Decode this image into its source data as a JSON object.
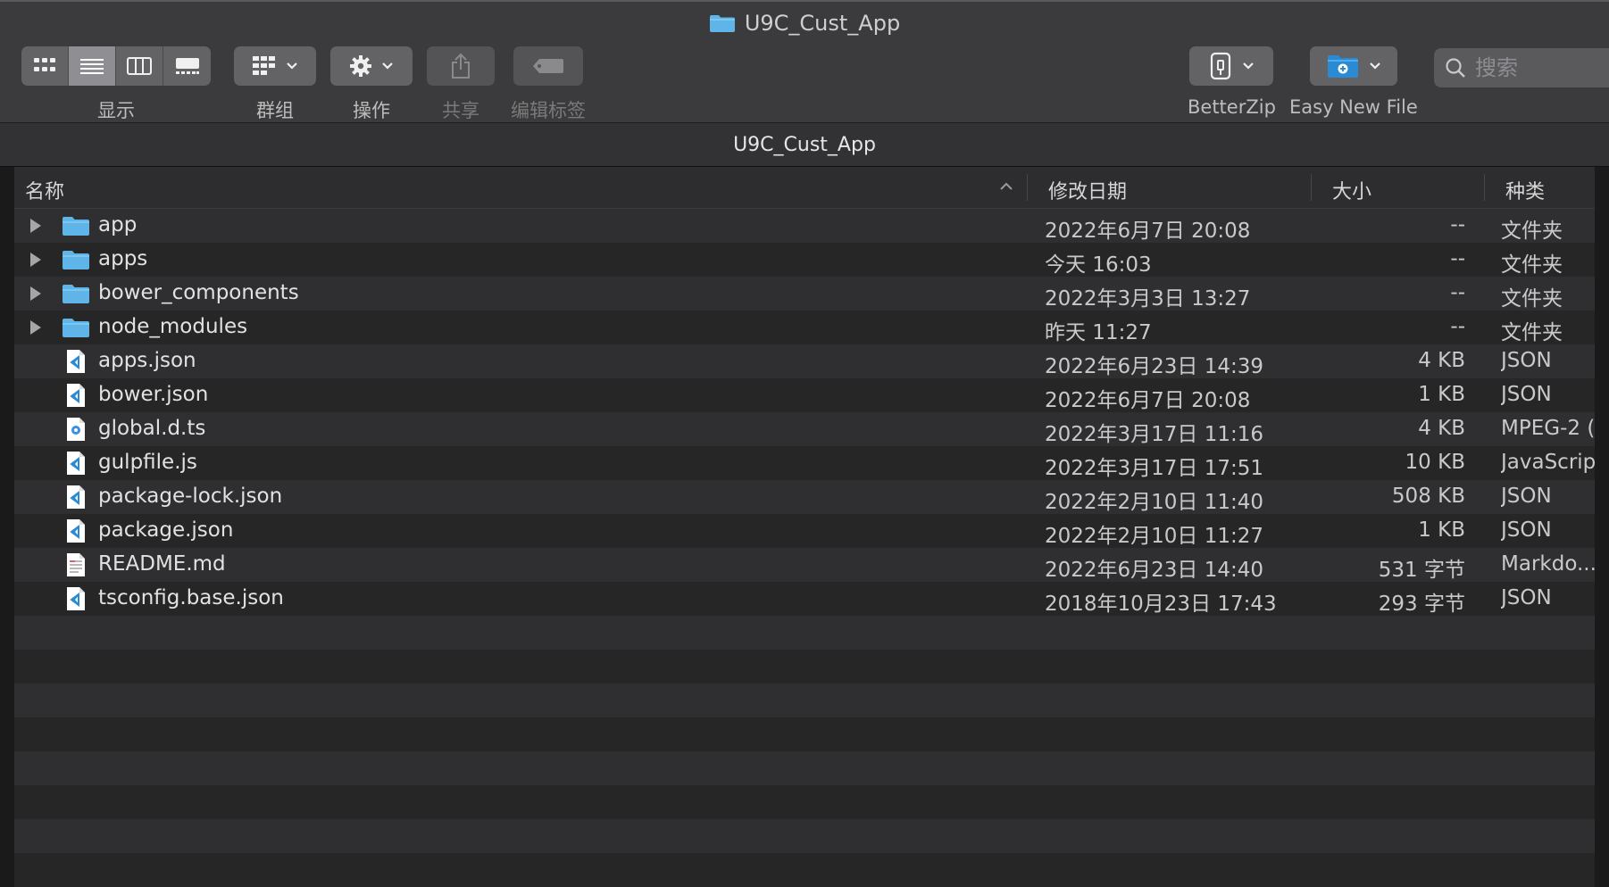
{
  "window": {
    "title": "U9C_Cust_App",
    "path_title": "U9C_Cust_App"
  },
  "toolbar": {
    "view_label": "显示",
    "group_label": "群组",
    "action_label": "操作",
    "share_label": "共享",
    "tags_label": "编辑标签",
    "betterzip_label": "BetterZip",
    "easynewfile_label": "Easy New File",
    "search_placeholder": "搜索"
  },
  "columns": {
    "name": "名称",
    "modified": "修改日期",
    "size": "大小",
    "kind": "种类"
  },
  "files": [
    {
      "name": "app",
      "modified": "2022年6月7日 20:08",
      "size": "--",
      "kind": "文件夹",
      "type": "folder"
    },
    {
      "name": "apps",
      "modified": "今天 16:03",
      "size": "--",
      "kind": "文件夹",
      "type": "folder"
    },
    {
      "name": "bower_components",
      "modified": "2022年3月3日 13:27",
      "size": "--",
      "kind": "文件夹",
      "type": "folder"
    },
    {
      "name": "node_modules",
      "modified": "昨天 11:27",
      "size": "--",
      "kind": "文件夹",
      "type": "folder"
    },
    {
      "name": "apps.json",
      "modified": "2022年6月23日 14:39",
      "size": "4 KB",
      "kind": "JSON",
      "type": "vscode"
    },
    {
      "name": "bower.json",
      "modified": "2022年6月7日 20:08",
      "size": "1 KB",
      "kind": "JSON",
      "type": "vscode"
    },
    {
      "name": "global.d.ts",
      "modified": "2022年3月17日 11:16",
      "size": "4 KB",
      "kind": "MPEG-2 (",
      "type": "media"
    },
    {
      "name": "gulpfile.js",
      "modified": "2022年3月17日 17:51",
      "size": "10 KB",
      "kind": "JavaScrip",
      "type": "vscode"
    },
    {
      "name": "package-lock.json",
      "modified": "2022年2月10日 11:40",
      "size": "508 KB",
      "kind": "JSON",
      "type": "vscode"
    },
    {
      "name": "package.json",
      "modified": "2022年2月10日 11:27",
      "size": "1 KB",
      "kind": "JSON",
      "type": "vscode"
    },
    {
      "name": "README.md",
      "modified": "2022年6月23日 14:40",
      "size": "531 字节",
      "kind": "Markdo...",
      "type": "text"
    },
    {
      "name": "tsconfig.base.json",
      "modified": "2018年10月23日 17:43",
      "size": "293 字节",
      "kind": "JSON",
      "type": "vscode"
    }
  ],
  "colors": {
    "folder": "#5fb4e8",
    "vscode": "#2a8ad4",
    "accent": "#3a7bd5"
  }
}
